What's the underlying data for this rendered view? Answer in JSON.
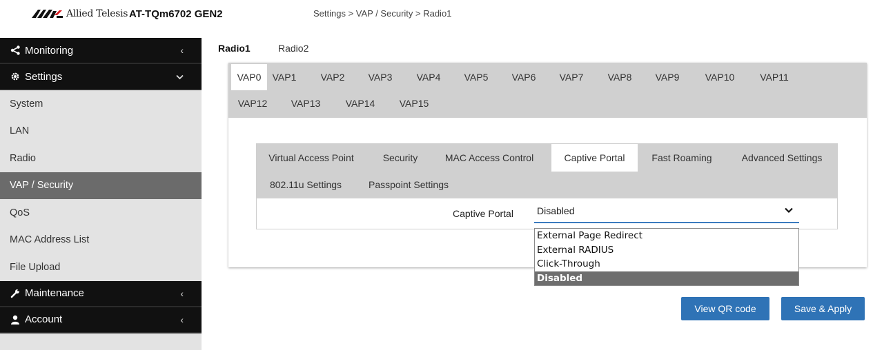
{
  "header": {
    "brand": "Allied Telesis",
    "product": "AT-TQm6702 GEN2",
    "breadcrumb": "Settings > VAP / Security > Radio1"
  },
  "sidebar": {
    "sections": [
      {
        "label": "Monitoring",
        "icon": "share-icon",
        "chevron": "chevron-left-icon"
      },
      {
        "label": "Settings",
        "icon": "gear-icon",
        "chevron": "chevron-down-icon"
      },
      {
        "label": "Maintenance",
        "icon": "wrench-icon",
        "chevron": "chevron-left-icon"
      },
      {
        "label": "Account",
        "icon": "user-icon",
        "chevron": "chevron-left-icon"
      }
    ],
    "settings_items": [
      "System",
      "LAN",
      "Radio",
      "VAP / Security",
      "QoS",
      "MAC Address List",
      "File Upload"
    ],
    "active_item": "VAP / Security"
  },
  "radio_tabs": [
    "Radio1",
    "Radio2"
  ],
  "active_radio": "Radio1",
  "vap_tabs": [
    "VAP0",
    "VAP1",
    "VAP2",
    "VAP3",
    "VAP4",
    "VAP5",
    "VAP6",
    "VAP7",
    "VAP8",
    "VAP9",
    "VAP10",
    "VAP11",
    "VAP12",
    "VAP13",
    "VAP14",
    "VAP15"
  ],
  "active_vap": "VAP0",
  "sub_tabs": [
    "Virtual Access Point",
    "Security",
    "MAC Access Control",
    "Captive Portal",
    "Fast Roaming",
    "Advanced Settings",
    "802.11u Settings",
    "Passpoint Settings"
  ],
  "active_sub_tab": "Captive Portal",
  "captive_portal": {
    "label": "Captive Portal",
    "value": "Disabled",
    "options": [
      "External Page Redirect",
      "External RADIUS",
      "Click-Through",
      "Disabled"
    ],
    "selected": "Disabled"
  },
  "buttons": {
    "qr": "View QR code",
    "save": "Save & Apply"
  },
  "colors": {
    "accent": "#2f73b6",
    "sidebar_dark": "#111111",
    "sidebar_active": "#6b6b6b",
    "tab_strip": "#d0d0d0"
  }
}
